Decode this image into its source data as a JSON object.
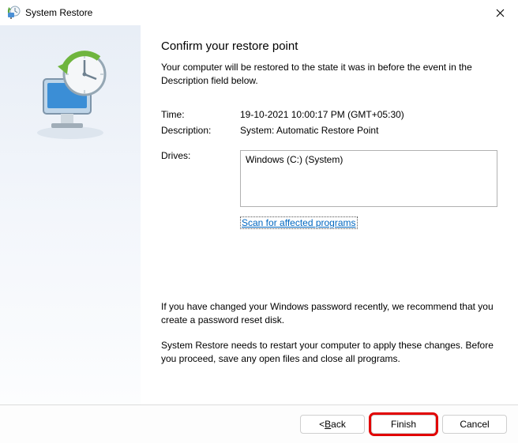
{
  "titlebar": {
    "title": "System Restore"
  },
  "heading": "Confirm your restore point",
  "intro": "Your computer will be restored to the state it was in before the event in the Description field below.",
  "fields": {
    "time_label": "Time:",
    "time_value": "19-10-2021 10:00:17 PM (GMT+05:30)",
    "description_label": "Description:",
    "description_value": "System: Automatic Restore Point",
    "drives_label": "Drives:",
    "drives_value": "Windows (C:) (System)"
  },
  "scan_link": "Scan for affected programs",
  "note1": "If you have changed your Windows password recently, we recommend that you create a password reset disk.",
  "note2": "System Restore needs to restart your computer to apply these changes. Before you proceed, save any open files and close all programs.",
  "buttons": {
    "back_prefix": "< ",
    "back_mn": "B",
    "back_suffix": "ack",
    "finish": "Finish",
    "cancel": "Cancel"
  }
}
